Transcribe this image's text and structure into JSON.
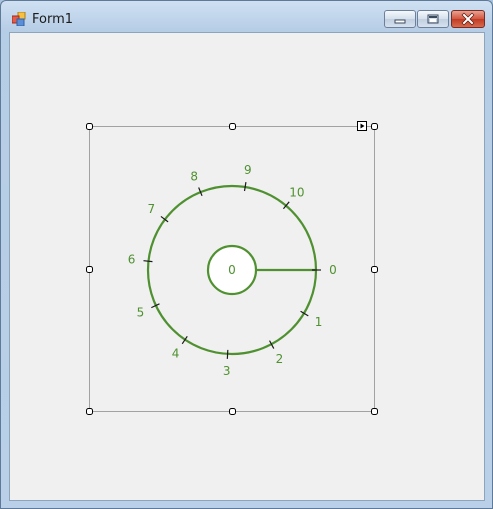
{
  "window": {
    "title": "Form1"
  },
  "title_controls": {
    "minimize": "minimize-icon",
    "maximize": "maximize-icon",
    "close": "close-icon"
  },
  "knob": {
    "scale_labels": [
      "0",
      "1",
      "2",
      "3",
      "4",
      "5",
      "6",
      "7",
      "8",
      "9",
      "10"
    ],
    "center_value": "0",
    "color": "#4f9130"
  },
  "colors": {
    "client_background": "#f0f0f0",
    "accent": "#4f9130",
    "close_button": "#c94a32"
  }
}
